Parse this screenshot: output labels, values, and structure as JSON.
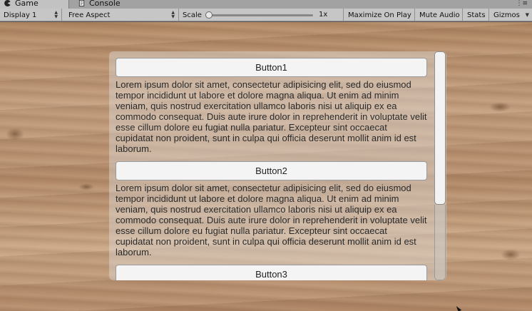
{
  "tabs": [
    {
      "label": "Game",
      "icon": "pacman-icon",
      "active": true
    },
    {
      "label": "Console",
      "icon": "console-icon",
      "active": false
    }
  ],
  "toolbar": {
    "display": "Display 1",
    "aspect": "Free Aspect",
    "scale_label": "Scale",
    "scale_value": "1x",
    "maximize": "Maximize On Play",
    "mute": "Mute Audio",
    "stats": "Stats",
    "gizmos": "Gizmos"
  },
  "scroll_view": {
    "items": [
      {
        "button": "Button1",
        "text": "Lorem ipsum dolor sit amet, consectetur adipisicing elit, sed do eiusmod tempor incididunt ut labore et dolore magna aliqua. Ut enim ad minim veniam, quis nostrud exercitation ullamco laboris nisi ut aliquip ex ea commodo consequat. Duis aute irure dolor in reprehenderit in voluptate velit esse cillum dolore eu fugiat nulla pariatur. Excepteur sint occaecat cupidatat non proident, sunt in culpa qui officia deserunt mollit anim id est laborum."
      },
      {
        "button": "Button2",
        "text": "Lorem ipsum dolor sit amet, consectetur adipisicing elit, sed do eiusmod tempor incididunt ut labore et dolore magna aliqua. Ut enim ad minim veniam, quis nostrud exercitation ullamco laboris nisi ut aliquip ex ea commodo consequat. Duis aute irure dolor in reprehenderit in voluptate velit esse cillum dolore eu fugiat nulla pariatur. Excepteur sint occaecat cupidatat non proident, sunt in culpa qui officia deserunt mollit anim id est laborum."
      },
      {
        "button": "Button3"
      }
    ]
  }
}
